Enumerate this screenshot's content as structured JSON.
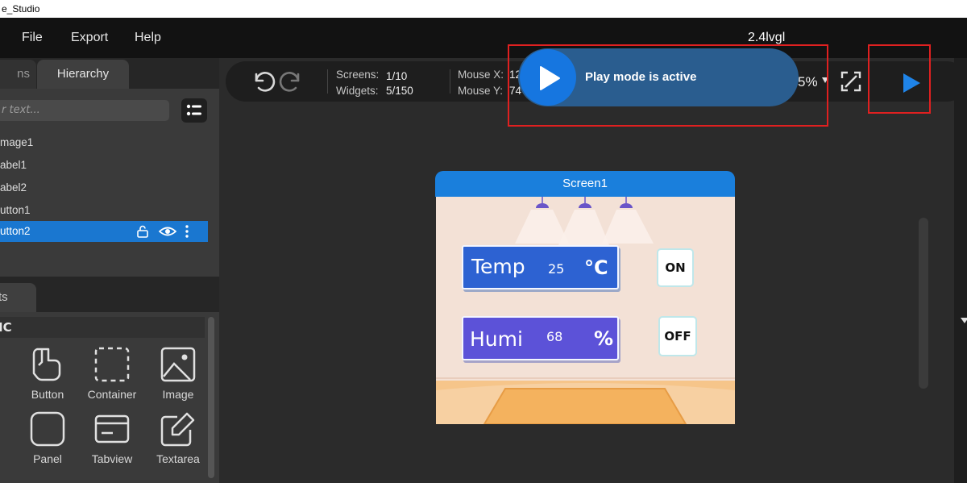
{
  "window": {
    "title": "e_Studio"
  },
  "menu": {
    "file": "File",
    "export": "Export",
    "help": "Help",
    "version": "2.4lvgl"
  },
  "left": {
    "tabs": {
      "screens_partial": "ns",
      "hierarchy": "Hierarchy"
    },
    "search_placeholder": "r text...",
    "tree": [
      {
        "label": "mage1"
      },
      {
        "label": "abel1"
      },
      {
        "label": "abel2"
      },
      {
        "label": "utton1"
      },
      {
        "label": "utton2"
      }
    ],
    "widgets_tab": "ts",
    "widgets_section": "IC",
    "widgets": [
      {
        "label": "Button",
        "icon": "button-icon"
      },
      {
        "label": "Container",
        "icon": "container-icon"
      },
      {
        "label": "Image",
        "icon": "image-icon"
      },
      {
        "label": "Panel",
        "icon": "panel-icon"
      },
      {
        "label": "Tabview",
        "icon": "tabview-icon"
      },
      {
        "label": "Textarea",
        "icon": "textarea-icon"
      }
    ]
  },
  "toolbar": {
    "screens_label": "Screens:",
    "screens_value": "1/10",
    "widgets_label": "Widgets:",
    "widgets_value": "5/150",
    "mouse_x_label": "Mouse X:",
    "mouse_x_value": "12",
    "mouse_y_label": "Mouse Y:",
    "mouse_y_value": "74",
    "zoom_partial": "5%"
  },
  "toast": {
    "text": "Play mode is active"
  },
  "preview": {
    "screen_title": "Screen1",
    "temp": {
      "label": "Temp",
      "value": "25",
      "unit": "°C"
    },
    "humi": {
      "label": "Humi",
      "value": "68",
      "unit": "%"
    },
    "on_button": "ON",
    "off_button": "OFF"
  },
  "colors": {
    "accent_blue": "#1a7fdc",
    "toast_bg": "#2a5d8f",
    "selection": "#1a77d0",
    "highlight_red": "#e02020"
  }
}
